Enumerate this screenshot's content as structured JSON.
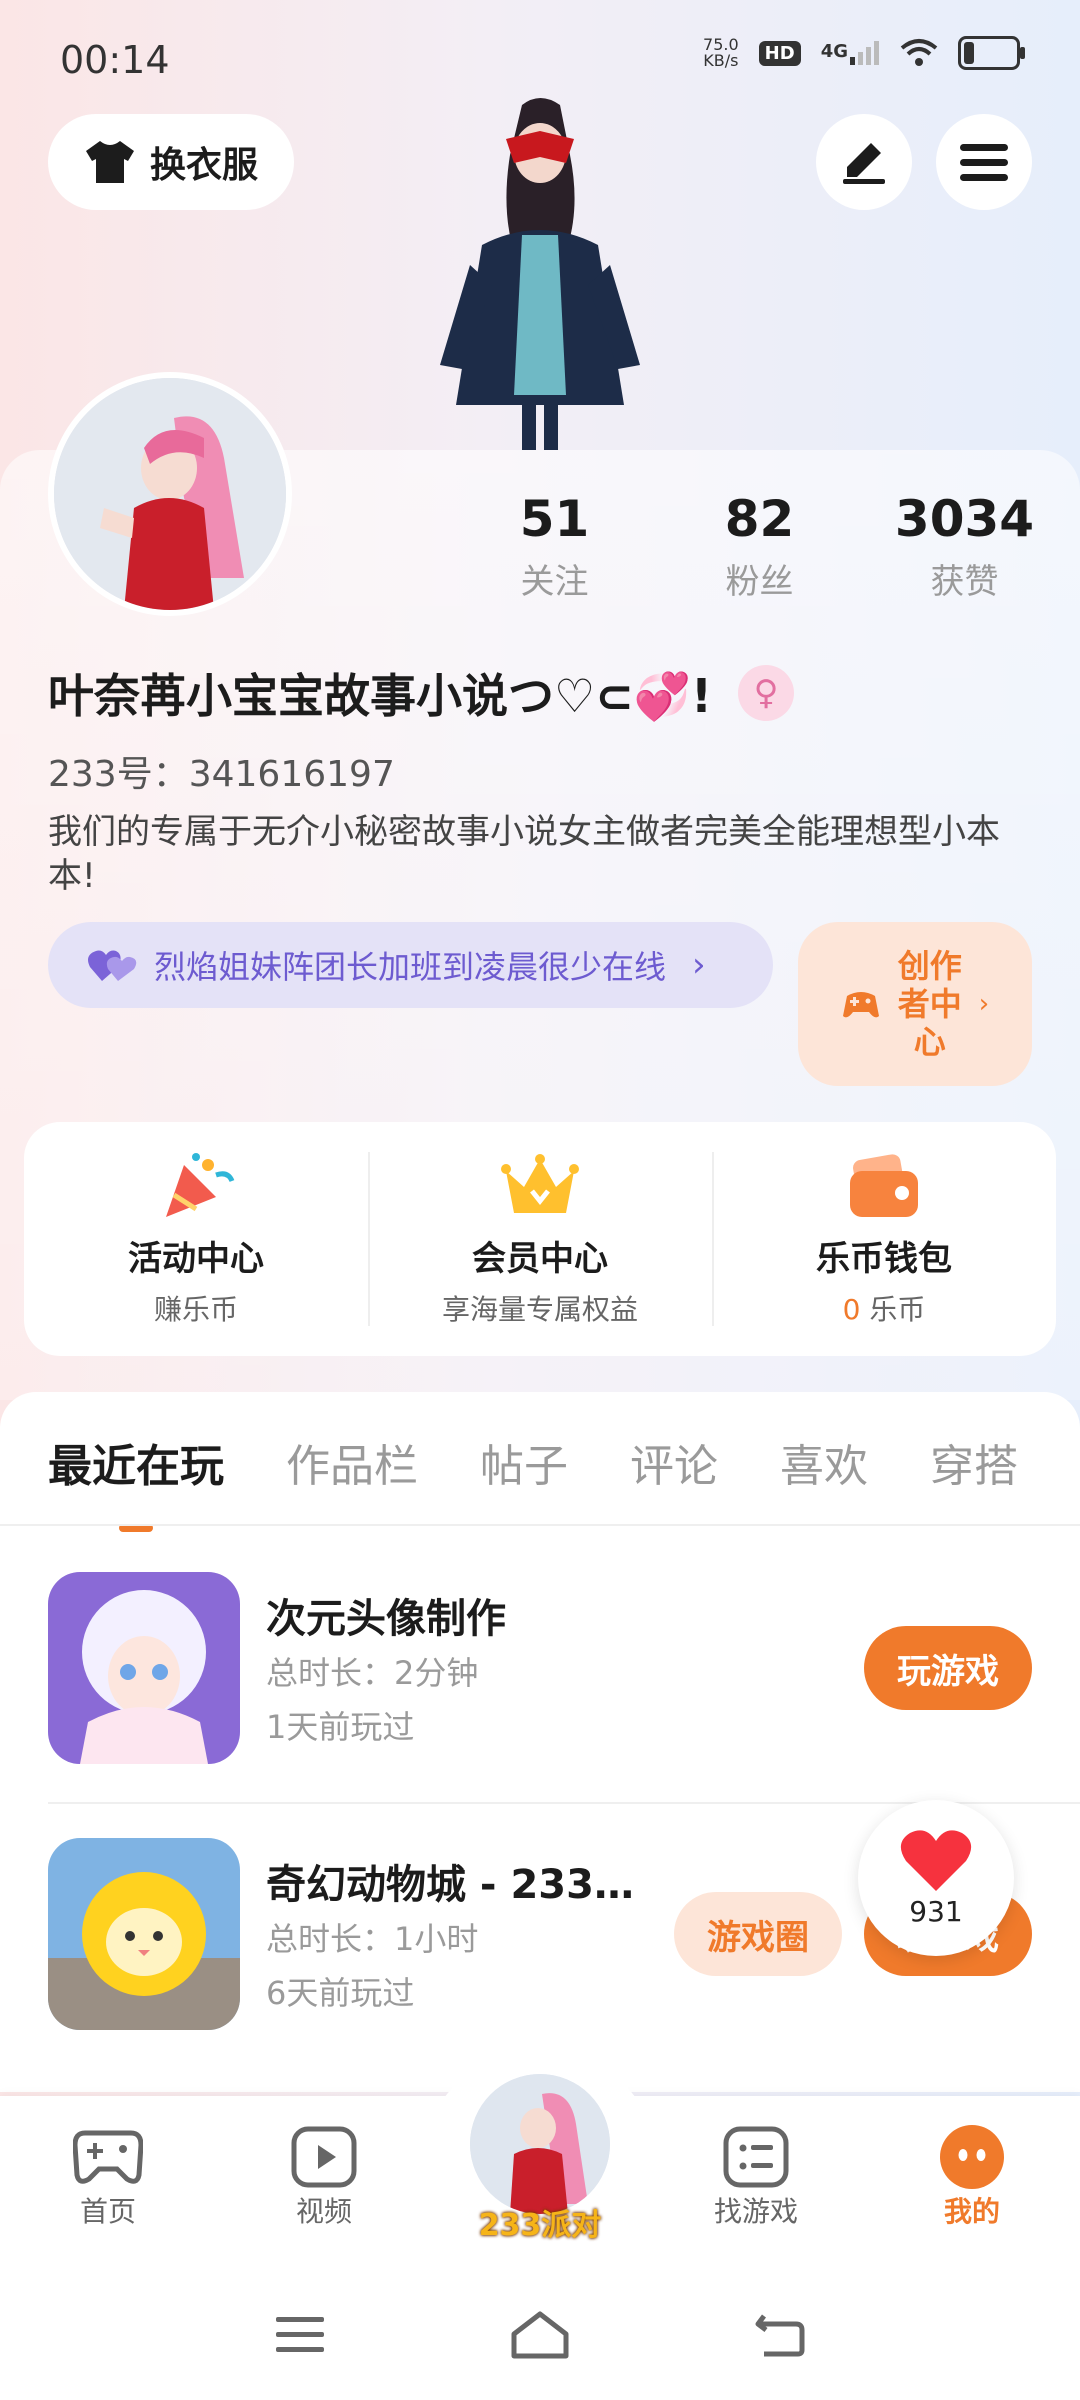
{
  "status_bar": {
    "time": "00:14",
    "net_speed_value": "75.0",
    "net_speed_unit": "KB/s",
    "hd": "HD",
    "network": "4G"
  },
  "top_buttons": {
    "outfit_label": "换衣服",
    "edit_icon": "pencil-icon",
    "menu_icon": "hamburger-menu-icon"
  },
  "profile": {
    "stats": [
      {
        "value": "51",
        "label": "关注"
      },
      {
        "value": "82",
        "label": "粉丝"
      },
      {
        "value": "3034",
        "label": "获赞"
      }
    ],
    "nickname": "叶奈苒小宝宝故事小说つ♡⊂💞!",
    "user_id": "233号：341616197",
    "bio": "我们的专属于无介小秘密故事小说女主做者完美全能理想型小本本!",
    "tag": "烈焰姐妹阵团长加班到凌晨很少在线",
    "creator_center": "创作者中心"
  },
  "features": [
    {
      "title": "活动中心",
      "subtitle": "赚乐币",
      "icon": "party-popper-icon"
    },
    {
      "title": "会员中心",
      "subtitle": "享海量专属权益",
      "icon": "crown-icon"
    },
    {
      "title": "乐币钱包",
      "amount": "0",
      "unit": "乐币",
      "icon": "wallet-icon"
    }
  ],
  "tabs": [
    "最近在玩",
    "作品栏",
    "帖子",
    "评论",
    "喜欢",
    "穿搭"
  ],
  "games": [
    {
      "name": "次元头像制作",
      "duration": "总时长：2分钟",
      "last_played": "1天前玩过",
      "button": "玩游戏"
    },
    {
      "name": "奇幻动物城 - 233…",
      "duration": "总时长：1小时",
      "last_played": "6天前玩过",
      "circle": "游戏圈",
      "button": "玩游戏"
    }
  ],
  "heart": {
    "count": "931"
  },
  "bottom_nav": [
    {
      "label": "首页"
    },
    {
      "label": "视频"
    },
    {
      "label": "233派对"
    },
    {
      "label": "找游戏"
    },
    {
      "label": "我的"
    }
  ],
  "colors": {
    "accent": "#f07a2b",
    "tag_purple": "#6d5bd0",
    "muted": "#9a9a9a"
  }
}
